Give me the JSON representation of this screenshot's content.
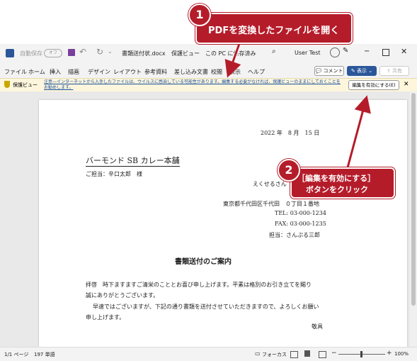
{
  "titlebar": {
    "autosave_label": "自動保存",
    "autosave_state": "オフ",
    "filename": "書類送付状.docx",
    "mode": "保護ビュー",
    "location": "この PC に保存済み",
    "user": "User Test"
  },
  "menu": {
    "items": [
      "ファイル",
      "ホーム",
      "挿入",
      "描画",
      "デザイン",
      "レイアウト",
      "参考資料",
      "差し込み文書",
      "校閲",
      "表示",
      "ヘルプ"
    ],
    "comment_label": "コメント",
    "display_label": "表示",
    "share_label": "共有"
  },
  "infobar": {
    "label": "保護ビュー",
    "message": "注意—インターネットから入手したファイルは、ウイルスに感染している可能性があります。編集する必要がなければ、保護ビューのままにしておくことをお勧めします。",
    "enable_button": "編集を有効にする(E)"
  },
  "document": {
    "date": "2022 年　8 月　15 日",
    "recipient": "バーモンド SB カレー本舗",
    "attention": "ご担当：辛口太郎　様",
    "sender_name": "えくせるさん",
    "address": "東京都千代田区千代田　０丁目１番地",
    "tel": "TEL: 03-000-1234",
    "fax": "FAX: 03-000-1235",
    "person": "担当：さんぷる三郎",
    "title": "書類送付のご案内",
    "body1": "拝啓　時下ますますご清栄のこととお喜び申し上げます。平素は格別のお引き立てを賜り",
    "body2": "誠にありがとうございます。",
    "body3": "早速ではございますが、下記の通り書類を送付させていただきますので、よろしくお願い",
    "body4": "申し上げます。",
    "closing": "敬具"
  },
  "status": {
    "page": "1/1 ページ",
    "words": "197 単語",
    "focus": "フォーカス",
    "zoom": "100%"
  },
  "callouts": {
    "one_num": "1",
    "one_text": "PDFを変換したファイルを開く",
    "two_num": "2",
    "two_line1": "［編集を有効にする］",
    "two_line2": "ボタンをクリック"
  },
  "colors": {
    "accent": "#b51c2a",
    "word_blue": "#2b579a"
  }
}
